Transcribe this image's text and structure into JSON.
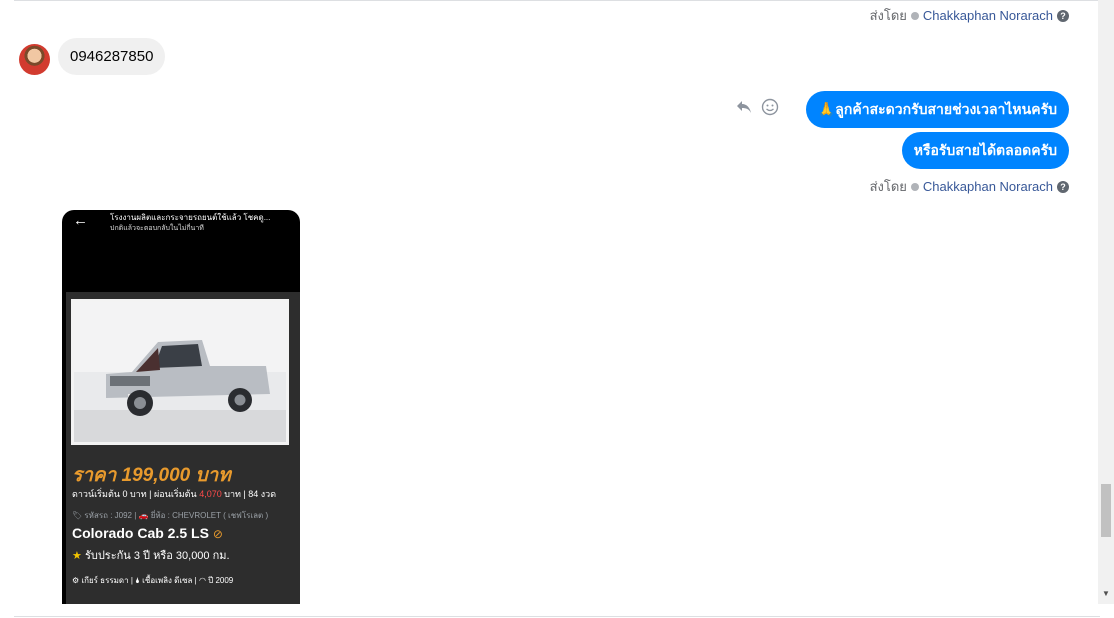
{
  "messages": {
    "sent_by_label": "ส่งโดย",
    "sender_name": "Chakkaphan Norarach",
    "help_glyph": "?",
    "incoming_text": "0946287850",
    "outgoing_1": "🙏ลูกค้าสะดวกรับสายช่วงเวลาไหนครับ",
    "outgoing_2": "หรือรับสายได้ตลอดครับ"
  },
  "card": {
    "header_line1": "โรงงานผลิตและกระจายรถยนต์ใช้แล้ว โชคดู...",
    "header_line2": "ปกติแล้วจะตอบกลับในไม่กี่นาที",
    "price": "ราคา 199,000 บาท",
    "terms_prefix": "ดาวน์เริ่มต้น 0 บาท | ผ่อนเริ่มต้น",
    "terms_highlight": "4,070",
    "terms_suffix": "บาท | 84 งวด",
    "meta": "🏷 รหัสรถ : J092 | 🚗 ยี่ห้อ : CHEVROLET ( เชฟโรเลต )",
    "model": "Colorado Cab 2.5 LS",
    "warranty": "รับประกัน 3 ปี หรือ 30,000 กม.",
    "specs": "⚙ เกียร์ ธรรมดา   |  🌢 เชื้อเพลิง ดีเซล   |  ◠ ปี 2009"
  },
  "icons": {
    "reply": "reply-icon",
    "emoji": "smiley-icon",
    "back": "back-arrow-icon",
    "check": "check-circle-icon",
    "star": "star-icon"
  }
}
